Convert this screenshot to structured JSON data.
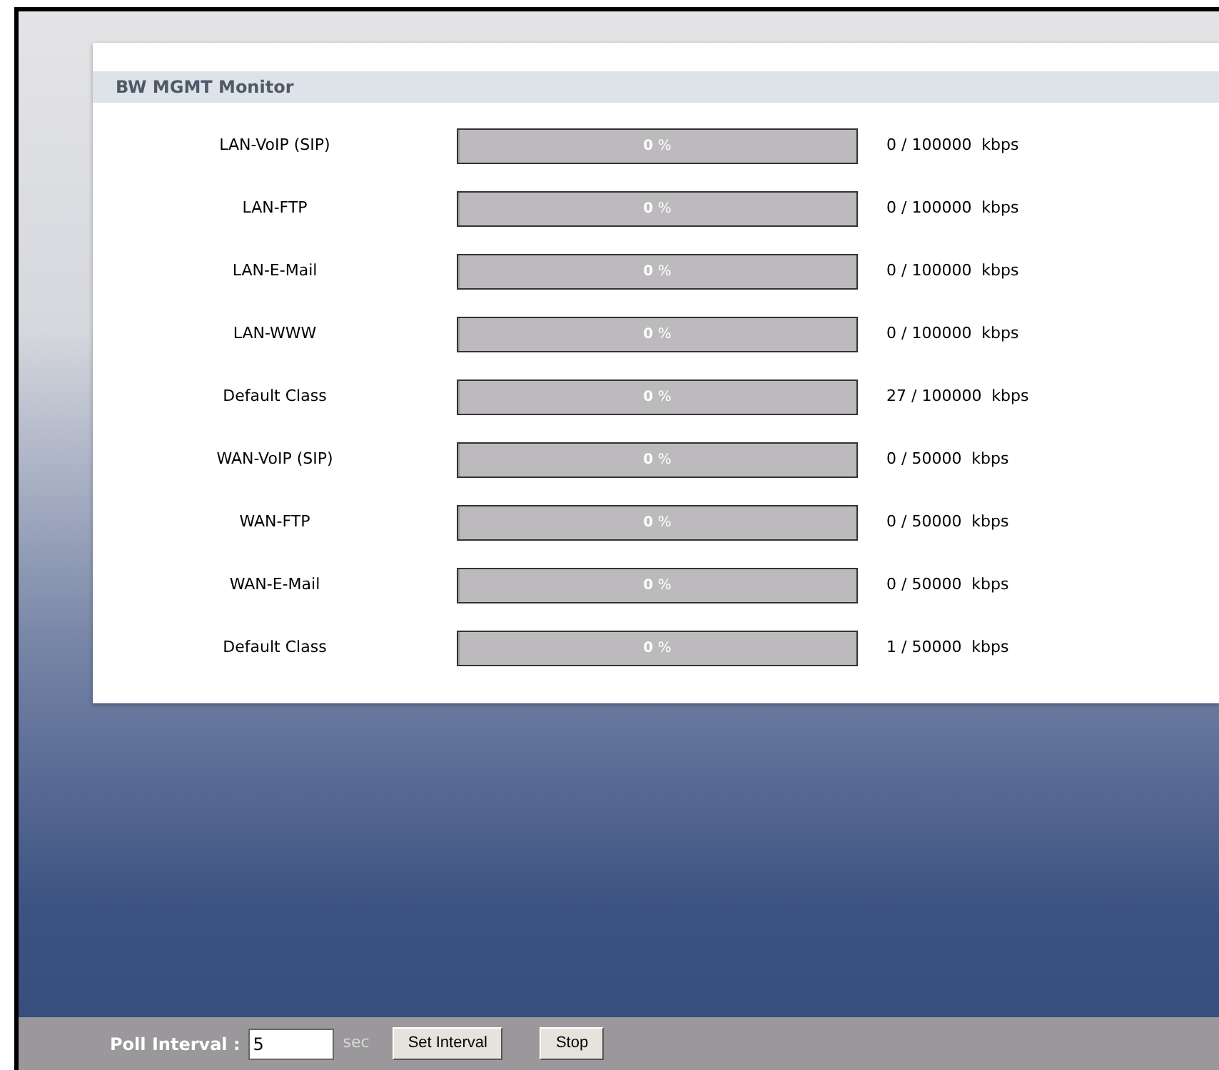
{
  "panel": {
    "title": "BW MGMT Monitor"
  },
  "rows": [
    {
      "name": "LAN-VoIP (SIP)",
      "level": 0,
      "percent": "**0** %",
      "reading": "0 / 100000  kbps"
    },
    {
      "name": "LAN-FTP",
      "level": 0,
      "percent": "**0** %",
      "reading": "0 / 100000  kbps"
    },
    {
      "name": "LAN-E-Mail",
      "level": 0,
      "percent": "**0** %",
      "reading": "0 / 100000  kbps"
    },
    {
      "name": "LAN-WWW",
      "level": 0,
      "percent": "**0** %",
      "reading": "0 / 100000  kbps"
    },
    {
      "name": "Default Class",
      "level": 0,
      "percent": "**0** %",
      "reading": "27 / 100000  kbps"
    },
    {
      "name": "WAN-VoIP (SIP)",
      "level": 0,
      "percent": "**0** %",
      "reading": "0 / 50000  kbps"
    },
    {
      "name": "WAN-FTP",
      "level": 0,
      "percent": "**0** %",
      "reading": "0 / 50000  kbps"
    },
    {
      "name": "WAN-E-Mail",
      "level": 0,
      "percent": "**0** %",
      "reading": "0 / 50000  kbps"
    },
    {
      "name": "Default Class",
      "level": 0,
      "percent": "**0** %",
      "reading": "1 / 50000  kbps"
    }
  ],
  "footer": {
    "label": "Poll Interval :",
    "interval": "5",
    "unit": "sec",
    "buttons": [
      "Set Interval",
      "Stop"
    ]
  }
}
